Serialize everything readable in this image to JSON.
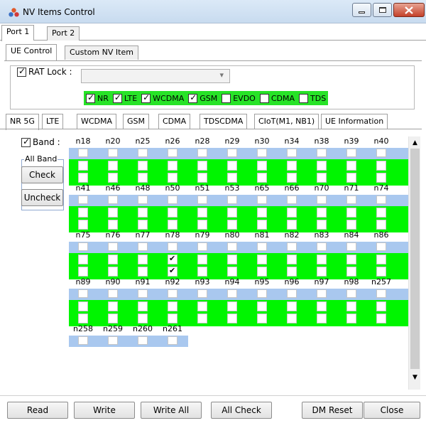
{
  "window": {
    "title": "NV Items Control"
  },
  "port_tabs": [
    "Port 1",
    "Port 2"
  ],
  "ue_tabs": [
    "UE Control",
    "Custom NV Item"
  ],
  "rat_lock": {
    "label": "RAT Lock :",
    "checked": true,
    "select_value": "",
    "options": [
      {
        "label": "NR",
        "checked": true
      },
      {
        "label": "LTE",
        "checked": true
      },
      {
        "label": "WCDMA",
        "checked": true
      },
      {
        "label": "GSM",
        "checked": true
      },
      {
        "label": "EVDO",
        "checked": false
      },
      {
        "label": "CDMA",
        "checked": false
      },
      {
        "label": "TDS",
        "checked": false
      }
    ]
  },
  "tech_tabs": [
    "NR 5G",
    "LTE",
    "WCDMA",
    "GSM",
    "CDMA",
    "TDSCDMA",
    "CIoT(M1, NB1)",
    "UE Information"
  ],
  "band": {
    "label": "Band :",
    "checked": true,
    "all_band_label": "All Band",
    "check_label": "Check",
    "uncheck_label": "Uncheck"
  },
  "band_rows": [
    [
      "n18",
      "n20",
      "n25",
      "n26",
      "n28",
      "n29",
      "n30",
      "n34",
      "n38",
      "n39",
      "n40"
    ],
    [
      "n41",
      "n46",
      "n48",
      "n50",
      "n51",
      "n53",
      "n65",
      "n66",
      "n70",
      "n71",
      "n74"
    ],
    [
      "n75",
      "n76",
      "n77",
      "n78",
      "n79",
      "n80",
      "n81",
      "n82",
      "n83",
      "n84",
      "n86"
    ],
    [
      "n89",
      "n90",
      "n91",
      "n92",
      "n93",
      "n94",
      "n95",
      "n96",
      "n97",
      "n98",
      "n257"
    ],
    [
      "n258",
      "n259",
      "n260",
      "n261"
    ]
  ],
  "ticked_band": "n78",
  "buttons": [
    "Read",
    "Write",
    "Write All",
    "All Check",
    "DM Reset",
    "Close"
  ]
}
